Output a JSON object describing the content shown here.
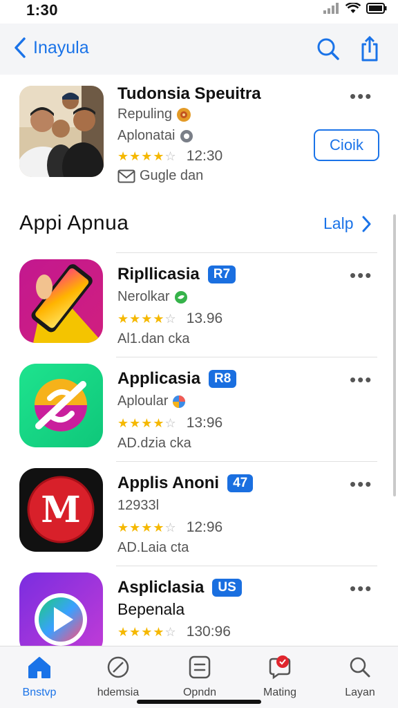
{
  "status": {
    "time": "1:30"
  },
  "nav": {
    "back_label": "Inayula"
  },
  "featured": {
    "title": "Tudonsia Speuitra",
    "line1": "Repuling",
    "line2": "Aplonatai",
    "rating_time": "12:30",
    "line4": "Gugle dan",
    "button_label": "Cioik",
    "stars": 4
  },
  "section": {
    "title": "Appi Apnua",
    "link_label": "Lalp"
  },
  "apps": [
    {
      "name": "Ripllicasia",
      "badge": "R7",
      "sub": "Nerolkar",
      "rating": "13.96",
      "meta": "Al1.dan cka",
      "stars": 4,
      "sub_color": "#36b34a"
    },
    {
      "name": "Applicasia",
      "badge": "R8",
      "sub": "Aploular",
      "rating": "13:96",
      "meta": "AD.dzia cka",
      "stars": 4,
      "sub_color": "#3c8ce7"
    },
    {
      "name": "Applis Anoni",
      "badge": "47",
      "sub": "12933l",
      "rating": "12:96",
      "meta": "AD.Laia cta",
      "stars": 4,
      "sub_color": ""
    },
    {
      "name": "Aspliclasia",
      "badge": "US",
      "sub": "Bepenala",
      "rating": "130:96",
      "meta": "",
      "stars": 4,
      "sub_color": ""
    }
  ],
  "tabs": [
    {
      "label": "Bnstvp",
      "icon": "home-icon",
      "active": true
    },
    {
      "label": "hdemsia",
      "icon": "compass-icon",
      "active": false
    },
    {
      "label": "Opndn",
      "icon": "list-icon",
      "active": false
    },
    {
      "label": "Mating",
      "icon": "notification-icon",
      "active": false
    },
    {
      "label": "Layan",
      "icon": "search-icon",
      "active": false
    }
  ],
  "colors": {
    "accent": "#1a73e8",
    "badge": "#1a6fe0",
    "star": "#f5b800"
  }
}
